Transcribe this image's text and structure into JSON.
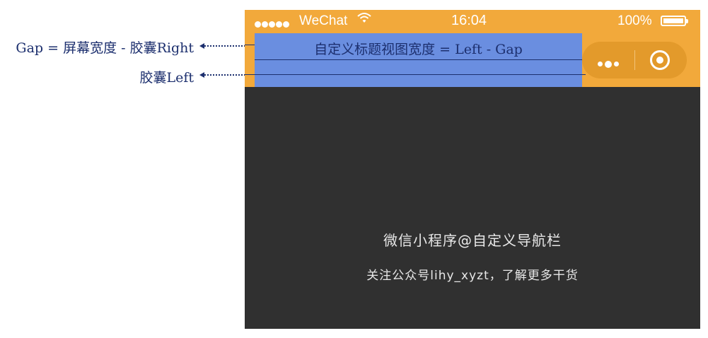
{
  "annotations": {
    "gap_formula": "Gap = 屏幕宽度 - 胶囊Right",
    "capsule_left": "胶囊Left",
    "title_view_formula": "自定义标题视图宽度 = Left  - Gap"
  },
  "status_bar": {
    "carrier": "WeChat",
    "time": "16:04",
    "battery": "100%",
    "battery_level": 1.0
  },
  "capsule": {
    "menu_icon": "more-dots-icon",
    "close_icon": "target-circle-icon"
  },
  "content": {
    "title": "微信小程序@自定义导航栏",
    "subtitle": "关注公众号lihy_xyzt，了解更多干货"
  },
  "colors": {
    "nav_background": "#f2a93b",
    "title_view": "#6a8ee0",
    "page_background": "#303030",
    "annotation": "#1c2f6e"
  }
}
